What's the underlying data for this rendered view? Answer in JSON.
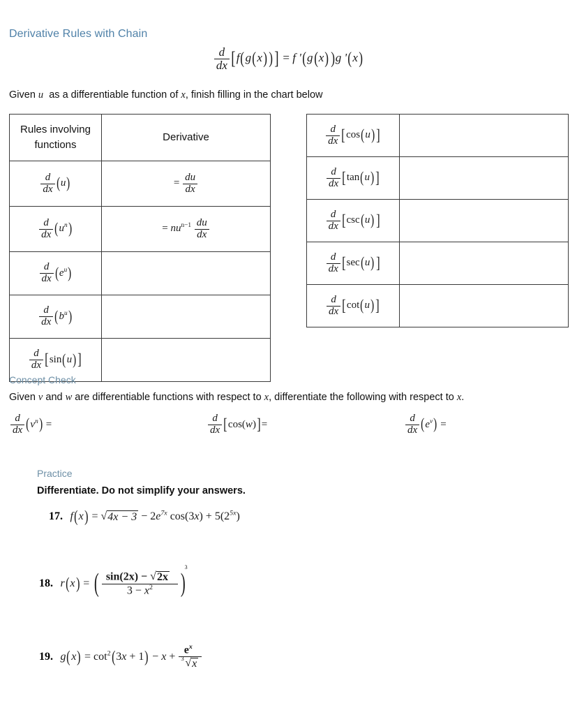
{
  "document": {
    "title": "Derivative Rules with Chain",
    "chain_rule_formula": "d/dx [ f( g(x) ) ] = f '( g(x) ) g '(x)",
    "instruction": "Given u as a differentiable function of x, finish filling in the chart below",
    "accent_title_color": "#4f81a8",
    "accent_section_color": "#6d8fa6"
  },
  "left_table": {
    "headers": [
      "Rules involving functions",
      "Derivative"
    ],
    "rows": [
      {
        "rule": "d/dx (u)",
        "derivative": "= du/dx"
      },
      {
        "rule": "d/dx (u^n)",
        "derivative": "= nu^(n-1) du/dx"
      },
      {
        "rule": "d/dx (e^u)",
        "derivative": ""
      },
      {
        "rule": "d/dx (b^u)",
        "derivative": ""
      },
      {
        "rule": "d/dx [sin(u)]",
        "derivative": ""
      }
    ]
  },
  "right_table": {
    "rows": [
      {
        "rule": "d/dx [cos(u)]",
        "derivative": ""
      },
      {
        "rule": "d/dx [tan(u)]",
        "derivative": ""
      },
      {
        "rule": "d/dx [csc(u)]",
        "derivative": ""
      },
      {
        "rule": "d/dx [sec(u)]",
        "derivative": ""
      },
      {
        "rule": "d/dx [cot(u)]",
        "derivative": ""
      }
    ]
  },
  "concept_check": {
    "heading": "Concept Check",
    "prompt": "Given v and w are differentiable functions with respect to x, differentiate the following with respect to x.",
    "items": [
      "d/dx (v^n) =",
      "d/dx [cos(w)] =",
      "d/dx (e^v) ="
    ]
  },
  "practice": {
    "heading": "Practice",
    "instruction": "Differentiate.  Do not simplify your answers.",
    "problems": [
      {
        "number": "17.",
        "expression": "f(x) = sqrt(4x - 3) - 2e^(7x) cos(3x) + 5(2^(5x))"
      },
      {
        "number": "18.",
        "expression": "r(x) = ( (sin(2x) - sqrt(2x)) / (3 - x^2) )^3"
      },
      {
        "number": "19.",
        "expression": "g(x) = cot^2(3x + 1) - x + e^x / cbrt(x)"
      }
    ]
  }
}
